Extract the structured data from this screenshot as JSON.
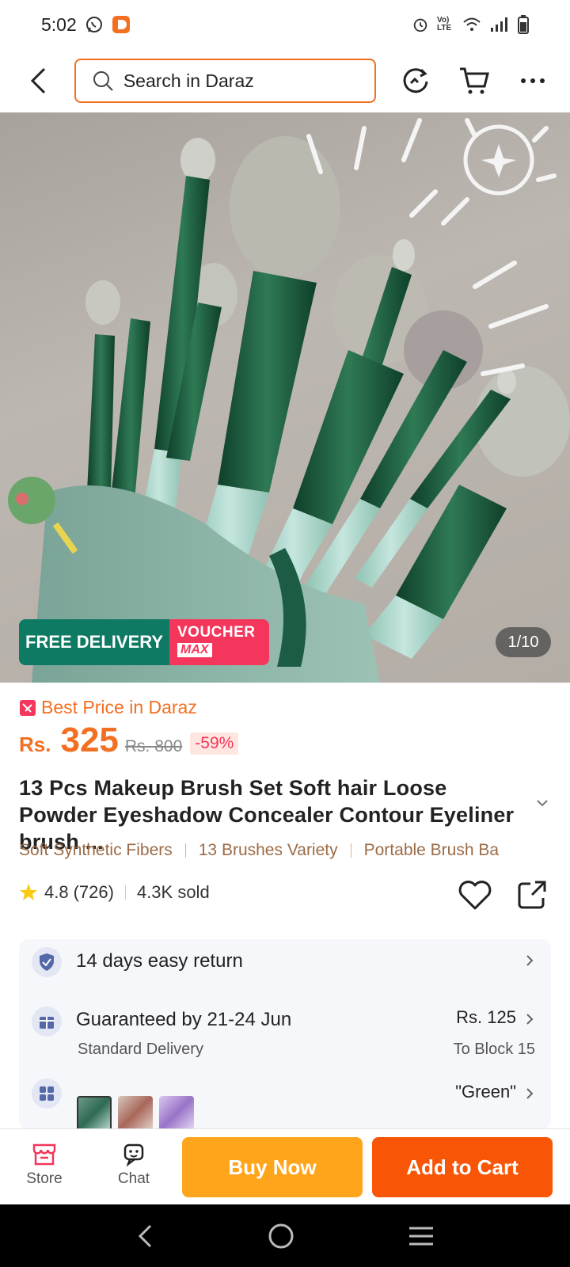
{
  "status_bar": {
    "time": "5:02",
    "net_label": "Vo) LTE"
  },
  "search": {
    "placeholder": "Search in Daraz"
  },
  "gallery": {
    "free_delivery": "FREE DELIVERY",
    "voucher_line1": "VOUCHER",
    "voucher_line2": "MAX",
    "counter": "1/10"
  },
  "price": {
    "best_price_label": "Best Price in Daraz",
    "currency": "Rs.",
    "current": "325",
    "original": "Rs. 800",
    "discount": "-59%"
  },
  "product": {
    "title": "13 Pcs Makeup Brush Set Soft hair Loose Powder Eyeshadow Concealer Contour Eyeliner brush ...",
    "tags": [
      "Soft Synthetic Fibers",
      "13 Brushes Variety",
      "Portable Brush Ba"
    ],
    "rating": "4.8",
    "reviews": "(726)",
    "sold": "4.3K sold"
  },
  "service": {
    "return_label": "14 days easy return",
    "delivery_label": "Guaranteed by 21-24 Jun",
    "delivery_sub": "Standard Delivery",
    "delivery_price": "Rs. 125",
    "delivery_dest": "To Block 15",
    "variant_value": "\"Green\""
  },
  "actions": {
    "store": "Store",
    "chat": "Chat",
    "buy_now": "Buy Now",
    "add_to_cart": "Add to Cart"
  },
  "colors": {
    "accent": "#f36f21",
    "buy_now": "#ffa51c",
    "add_to_cart": "#f85606",
    "free_delivery": "#0f7a63",
    "voucher": "#f5365c",
    "tag_text": "#9c6b46"
  }
}
